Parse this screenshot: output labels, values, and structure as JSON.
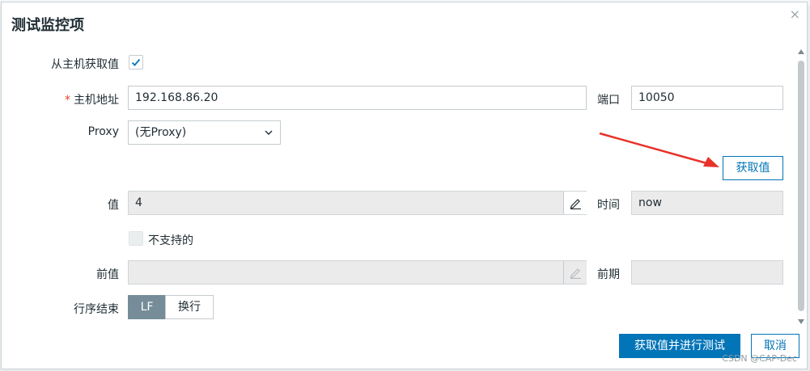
{
  "dialog": {
    "title": "测试监控项",
    "close_symbol": "×"
  },
  "form": {
    "from_host": {
      "label": "从主机获取值",
      "checked": true
    },
    "host_address": {
      "required_mark": "*",
      "label": "主机地址",
      "value": "192.168.86.20"
    },
    "port": {
      "label": "端口",
      "value": "10050"
    },
    "proxy": {
      "label": "Proxy",
      "selected": "(无Proxy)"
    },
    "get_value_button": "获取值",
    "value": {
      "label": "值",
      "value": "4"
    },
    "time": {
      "label": "时间",
      "value": "now"
    },
    "not_supported": {
      "label": "不支持的",
      "checked": false
    },
    "previous_value": {
      "label": "前值",
      "value": ""
    },
    "previous_time": {
      "label": "前期",
      "value": ""
    },
    "eol": {
      "label": "行序结束",
      "options": [
        "LF",
        "换行"
      ],
      "selected": "LF"
    }
  },
  "footer": {
    "submit_button": "获取值并进行测试",
    "cancel_button": "取消"
  },
  "watermark": "CSDN @CAP-Dec",
  "colors": {
    "accent": "#0275b8",
    "arrow": "#e8322a",
    "segment_active": "#768d99",
    "readonly_bg": "#ebebeb"
  }
}
